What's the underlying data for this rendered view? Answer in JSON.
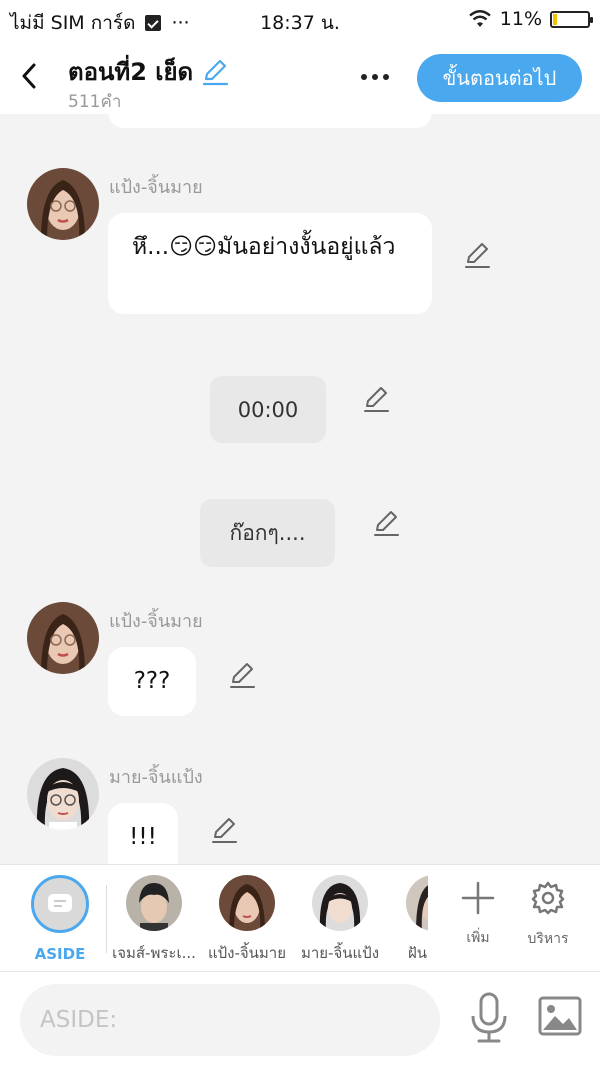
{
  "status": {
    "carrier": "ไม่มี SIM การ์ด",
    "dots": "···",
    "time": "18:37 น.",
    "battery": "11%",
    "battery_level": 0.11
  },
  "header": {
    "title": "ตอนที่2 เย็ด",
    "word_count": "511คำ",
    "next_label": "ขั้นตอนต่อไป"
  },
  "messages": [
    {
      "type": "character",
      "speaker": "แป้ง-จิ้นมาย",
      "text": "หึ...😏😏มันอย่างงั้นอยู่แล้ว"
    },
    {
      "type": "narration",
      "text": "00:00"
    },
    {
      "type": "narration",
      "text": "ก๊อกๆ...."
    },
    {
      "type": "character",
      "speaker": "แป้ง-จิ้นมาย",
      "text": "???"
    },
    {
      "type": "character",
      "speaker": "มาย-จิ้นแป้ง",
      "text": "!!!"
    }
  ],
  "characters": [
    {
      "label": "ASIDE"
    },
    {
      "label": "เจมส์-พระเ..."
    },
    {
      "label": "แป้ง-จิ้นมาย"
    },
    {
      "label": "มาย-จิ้นแป้ง"
    },
    {
      "label": "ฝัน"
    }
  ],
  "tools": {
    "add_label": "เพิ่ม",
    "manage_label": "บริหาร"
  },
  "input": {
    "placeholder": "ASIDE:"
  },
  "colors": {
    "accent": "#4aa8ee",
    "background": "#f3f3f3"
  }
}
